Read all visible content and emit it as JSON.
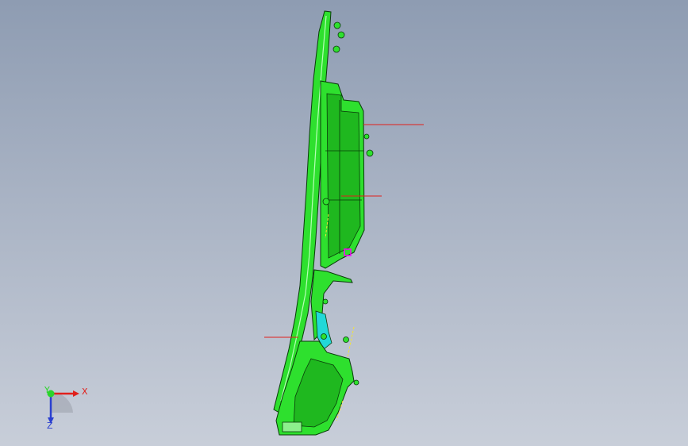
{
  "viewport": {
    "background_top": "#8e9cb2",
    "background_bottom": "#c8ced9"
  },
  "model": {
    "body_color": "#2ee02e",
    "body_shade": "#1fb81f",
    "outline_color": "#0a3a0a",
    "accent_color": "#22d8d8",
    "highlight_color": "#ff00ff",
    "dimension_line_color": "#e0201c",
    "guide_line_color": "#f4e33a"
  },
  "triad": {
    "x_label": "X",
    "y_label": "Y",
    "z_label": "Z",
    "x_color": "#e0201c",
    "y_color": "#2bd42b",
    "z_color": "#2a3fd0"
  }
}
